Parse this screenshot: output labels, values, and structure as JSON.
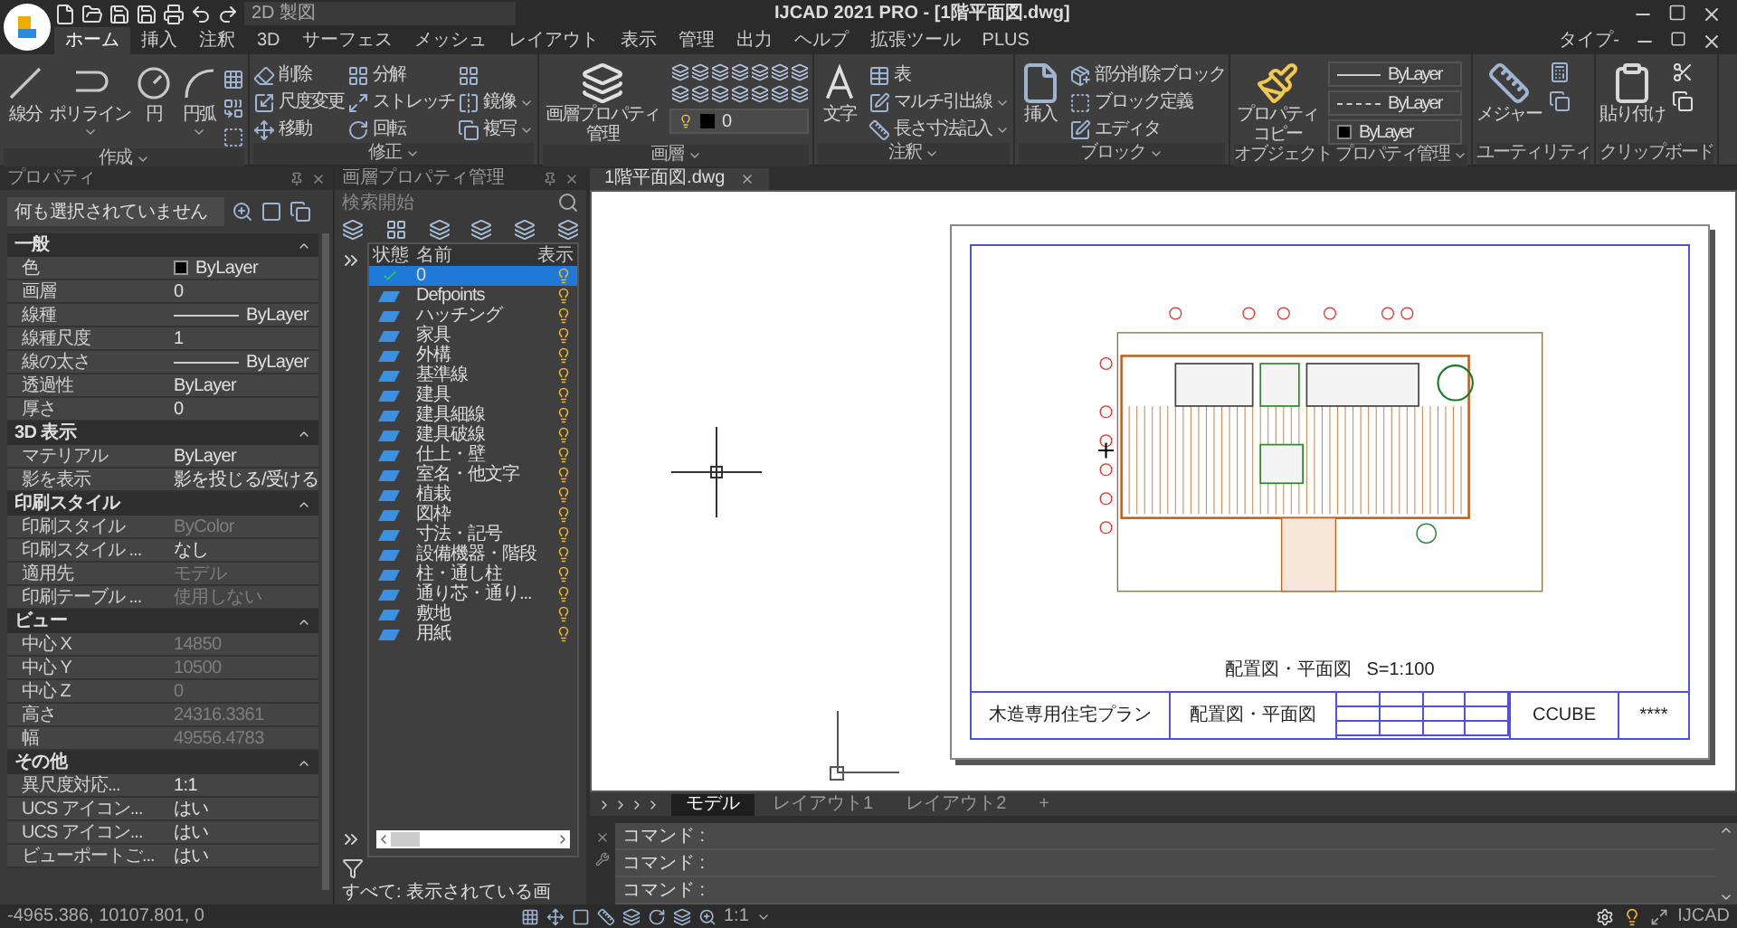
{
  "title_bar": {
    "workspace": "2D 製図",
    "title": "IJCAD 2021 PRO - [1階平面図.dwg]"
  },
  "menu_tabs": [
    {
      "label": "ホーム",
      "selected": true
    },
    {
      "label": "挿入",
      "selected": false
    },
    {
      "label": "注釈",
      "selected": false
    },
    {
      "label": "3D",
      "selected": false
    },
    {
      "label": "サーフェス",
      "selected": false
    },
    {
      "label": "メッシュ",
      "selected": false
    },
    {
      "label": "レイアウト",
      "selected": false
    },
    {
      "label": "表示",
      "selected": false
    },
    {
      "label": "管理",
      "selected": false
    },
    {
      "label": "出力",
      "selected": false
    },
    {
      "label": "ヘルプ",
      "selected": false
    },
    {
      "label": "拡張ツール",
      "selected": false
    },
    {
      "label": "PLUS",
      "selected": false
    }
  ],
  "help_search": "タイプ-",
  "ribbon": [
    {
      "kind": "draw",
      "label": "作成",
      "menu": true,
      "tools": [
        "線分",
        "ポリライン",
        "円",
        "円弧"
      ]
    },
    {
      "kind": "modify",
      "label": "修正",
      "menu": true,
      "tools": [
        "削除",
        "尺度変更",
        "移動",
        "分解",
        "ストレッチ",
        "回転",
        "鏡像",
        "複写"
      ]
    },
    {
      "kind": "layer",
      "label": "画層",
      "menu": true,
      "button": "画層プロパティ管理",
      "current_layer": "0"
    },
    {
      "kind": "annotate",
      "label": "注釈",
      "menu": true,
      "button": "文字",
      "tools": [
        "表",
        "マルチ引出線",
        "長さ寸法記入"
      ]
    },
    {
      "kind": "block",
      "label": "ブロック",
      "menu": true,
      "button": "挿入",
      "tools": [
        "部分削除ブロック",
        "ブロック定義",
        "エディタ"
      ]
    },
    {
      "kind": "properties",
      "label": "オブジェクト プロパティ管理",
      "menu": true,
      "button": "プロパティコピー",
      "fields": [
        {
          "kind": "lineweight",
          "value": "ByLayer"
        },
        {
          "kind": "linetype",
          "value": "ByLayer"
        },
        {
          "kind": "color",
          "value": "ByLayer"
        }
      ]
    },
    {
      "kind": "utility",
      "label": "ユーティリティ",
      "menu": false,
      "button": "メジャー"
    },
    {
      "kind": "clipboard",
      "label": "クリップボード",
      "menu": false,
      "button": "貼り付け"
    }
  ],
  "properties": {
    "title": "プロパティ",
    "selection": "何も選択されていません",
    "sections": [
      {
        "title": "一般",
        "expanded": true,
        "rows": [
          {
            "label": "色",
            "value": "ByLayer",
            "kind": "color",
            "disabled": false
          },
          {
            "label": "画層",
            "value": "0",
            "kind": "text",
            "disabled": false
          },
          {
            "label": "線種",
            "value": "ByLayer",
            "kind": "line",
            "disabled": false
          },
          {
            "label": "線種尺度",
            "value": "1",
            "kind": "text",
            "disabled": false
          },
          {
            "label": "線の太さ",
            "value": "ByLayer",
            "kind": "line",
            "disabled": false
          },
          {
            "label": "透過性",
            "value": "ByLayer",
            "kind": "text",
            "disabled": false
          },
          {
            "label": "厚さ",
            "value": "0",
            "kind": "text",
            "disabled": false
          }
        ]
      },
      {
        "title": "3D 表示",
        "expanded": true,
        "rows": [
          {
            "label": "マテリアル",
            "value": "ByLayer",
            "kind": "text",
            "disabled": false
          },
          {
            "label": "影を表示",
            "value": "影を投じる/受ける",
            "kind": "text",
            "disabled": false
          }
        ]
      },
      {
        "title": "印刷スタイル",
        "expanded": true,
        "rows": [
          {
            "label": "印刷スタイル",
            "value": "ByColor",
            "kind": "text",
            "disabled": true
          },
          {
            "label": "印刷スタイル ...",
            "value": "なし",
            "kind": "text",
            "disabled": false
          },
          {
            "label": "適用先",
            "value": "モデル",
            "kind": "text",
            "disabled": true
          },
          {
            "label": "印刷テーブル ...",
            "value": "使用しない",
            "kind": "text",
            "disabled": true
          }
        ]
      },
      {
        "title": "ビュー",
        "expanded": true,
        "rows": [
          {
            "label": "中心 X",
            "value": "14850",
            "kind": "text",
            "disabled": true
          },
          {
            "label": "中心 Y",
            "value": "10500",
            "kind": "text",
            "disabled": true
          },
          {
            "label": "中心 Z",
            "value": "0",
            "kind": "text",
            "disabled": true
          },
          {
            "label": "高さ",
            "value": "24316.3361",
            "kind": "text",
            "disabled": true
          },
          {
            "label": "幅",
            "value": "49556.4783",
            "kind": "text",
            "disabled": true
          }
        ]
      },
      {
        "title": "その他",
        "expanded": true,
        "rows": [
          {
            "label": "異尺度対応...",
            "value": "1:1",
            "kind": "text",
            "disabled": false
          },
          {
            "label": "UCS アイコン...",
            "value": "はい",
            "kind": "text",
            "disabled": false
          },
          {
            "label": "UCS アイコン...",
            "value": "はい",
            "kind": "text",
            "disabled": false
          },
          {
            "label": "ビューポートご...",
            "value": "はい",
            "kind": "text",
            "disabled": false
          }
        ]
      }
    ]
  },
  "layers": {
    "title": "画層プロパティ管理",
    "search_placeholder": "検索開始",
    "columns": [
      "状態",
      "名前",
      "表示"
    ],
    "rows": [
      {
        "name": "0",
        "current": true,
        "selected": true,
        "visible": true
      },
      {
        "name": "Defpoints",
        "current": false,
        "selected": false,
        "visible": true
      },
      {
        "name": "ハッチング",
        "current": false,
        "selected": false,
        "visible": true
      },
      {
        "name": "家具",
        "current": false,
        "selected": false,
        "visible": true
      },
      {
        "name": "外構",
        "current": false,
        "selected": false,
        "visible": true
      },
      {
        "name": "基準線",
        "current": false,
        "selected": false,
        "visible": true
      },
      {
        "name": "建具",
        "current": false,
        "selected": false,
        "visible": true
      },
      {
        "name": "建具細線",
        "current": false,
        "selected": false,
        "visible": true
      },
      {
        "name": "建具破線",
        "current": false,
        "selected": false,
        "visible": true
      },
      {
        "name": "仕上・壁",
        "current": false,
        "selected": false,
        "visible": true
      },
      {
        "name": "室名・他文字",
        "current": false,
        "selected": false,
        "visible": true
      },
      {
        "name": "植栽",
        "current": false,
        "selected": false,
        "visible": true
      },
      {
        "name": "図枠",
        "current": false,
        "selected": false,
        "visible": true
      },
      {
        "name": "寸法・記号",
        "current": false,
        "selected": false,
        "visible": true
      },
      {
        "name": "設備機器・階段",
        "current": false,
        "selected": false,
        "visible": true
      },
      {
        "name": "柱・通し柱",
        "current": false,
        "selected": false,
        "visible": true
      },
      {
        "name": "通り芯・通り...",
        "current": false,
        "selected": false,
        "visible": true
      },
      {
        "name": "敷地",
        "current": false,
        "selected": false,
        "visible": true
      },
      {
        "name": "用紙",
        "current": false,
        "selected": false,
        "visible": true
      }
    ],
    "filter": "すべて: 表示されている画"
  },
  "document_tab": "1階平面図.dwg",
  "drawing": {
    "caption": "配置図・平面図",
    "scale": "S=1:100",
    "title_block": {
      "project": "木造専用住宅プラン",
      "drawing": "配置図・平面図",
      "company": "CCUBE",
      "number": "****"
    }
  },
  "layout_tabs": [
    {
      "label": "モデル",
      "selected": true
    },
    {
      "label": "レイアウト1",
      "selected": false
    },
    {
      "label": "レイアウト2",
      "selected": false
    },
    {
      "label": "+",
      "selected": false
    }
  ],
  "commands": [
    "コマンド :",
    "コマンド :",
    "コマンド :"
  ],
  "status_bar": {
    "coordinates": "-4965.386, 10107.801, 0",
    "scale": "1:1",
    "brand": "IJCAD"
  }
}
